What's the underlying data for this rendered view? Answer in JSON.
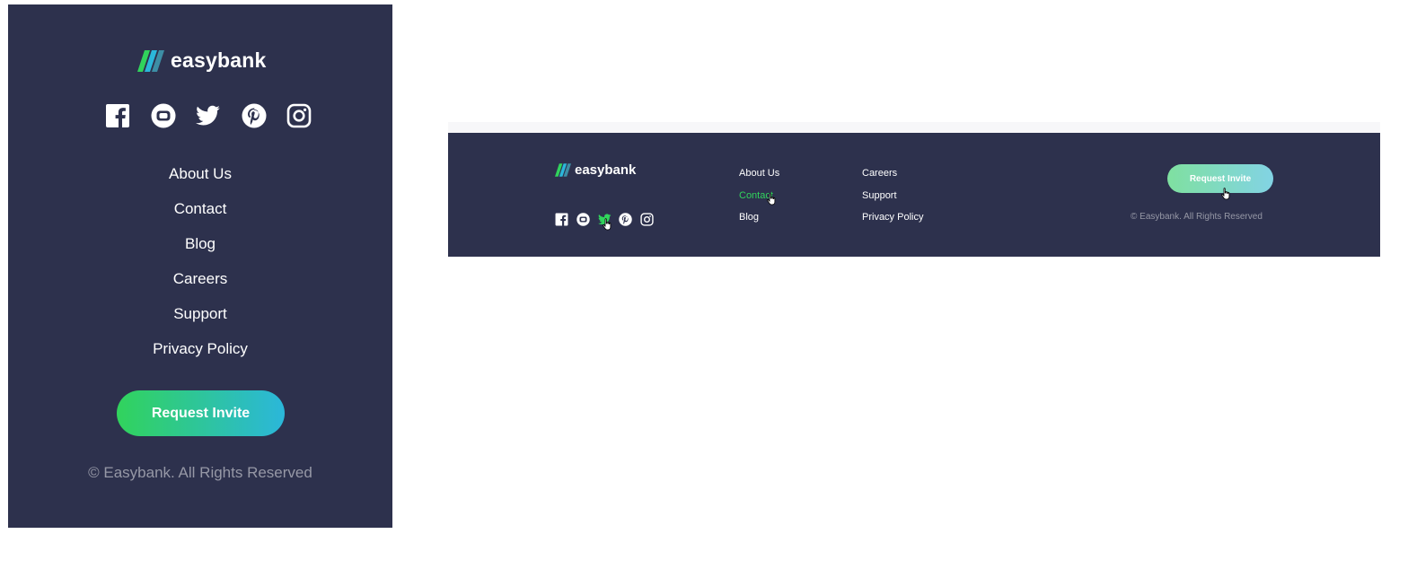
{
  "brand": {
    "name": "easybank",
    "colors": {
      "footer_bg": "#2d314d",
      "accent_green": "#31d35c",
      "accent_cyan": "#2bb7da",
      "muted_text": "#9698a6"
    }
  },
  "social_icons": [
    "facebook-icon",
    "youtube-icon",
    "twitter-icon",
    "pinterest-icon",
    "instagram-icon"
  ],
  "mobile_footer": {
    "links": [
      "About Us",
      "Contact",
      "Blog",
      "Careers",
      "Support",
      "Privacy Policy"
    ],
    "button_label": "Request Invite",
    "copyright": "© Easybank. All Rights Reserved"
  },
  "desktop_footer": {
    "links_col1": [
      "About Us",
      "Contact",
      "Blog"
    ],
    "links_col2": [
      "Careers",
      "Support",
      "Privacy Policy"
    ],
    "hovered_link": "Contact",
    "hovered_social": "twitter-icon",
    "button_label": "Request Invite",
    "copyright": "© Easybank. All Rights Reserved"
  }
}
